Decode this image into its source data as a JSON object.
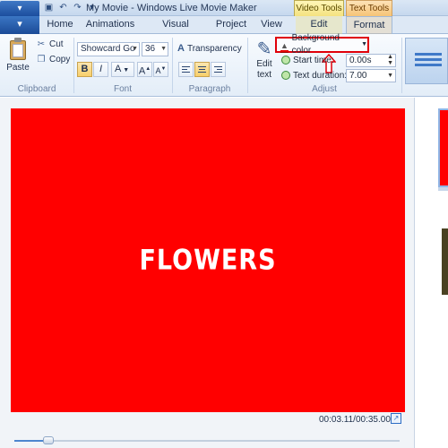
{
  "titlebar": {
    "app_menu_label": "▾",
    "title": "My Movie - Windows Live Movie Maker",
    "contextual": {
      "video_tools": "Video Tools",
      "text_tools": "Text Tools"
    },
    "quick_access_icons": [
      "save-icon",
      "undo-icon",
      "redo-icon",
      "customize-icon"
    ]
  },
  "tabs": {
    "file": "▾",
    "items": [
      {
        "label": "Home"
      },
      {
        "label": "Animations"
      },
      {
        "label": "Visual Effects"
      },
      {
        "label": "Project"
      },
      {
        "label": "View"
      },
      {
        "label": "Edit"
      },
      {
        "label": "Format",
        "active": true
      }
    ]
  },
  "ribbon": {
    "clipboard": {
      "paste": "Paste",
      "cut": "Cut",
      "copy": "Copy",
      "group": "Clipboard"
    },
    "font": {
      "family": "Showcard Go",
      "size": "36",
      "bold": "B",
      "italic": "I",
      "color": "A",
      "grow": "A",
      "shrink": "A",
      "group": "Font"
    },
    "paragraph": {
      "transparency": "Transparency",
      "group": "Paragraph"
    },
    "adjust": {
      "edit_text_line1": "Edit",
      "edit_text_line2": "text",
      "background_color": "Background color",
      "background_color_value": "#ff0000",
      "start_time_label": "Start time:",
      "start_time_value": "0.00s",
      "text_duration_label": "Text duration:",
      "text_duration_value": "7.00",
      "group": "Adjust"
    }
  },
  "preview": {
    "caption": "FLOWERS",
    "background_color": "#ff0000",
    "timecode": "00:03.11/00:35.00",
    "seek_position_fraction": 0.089
  }
}
